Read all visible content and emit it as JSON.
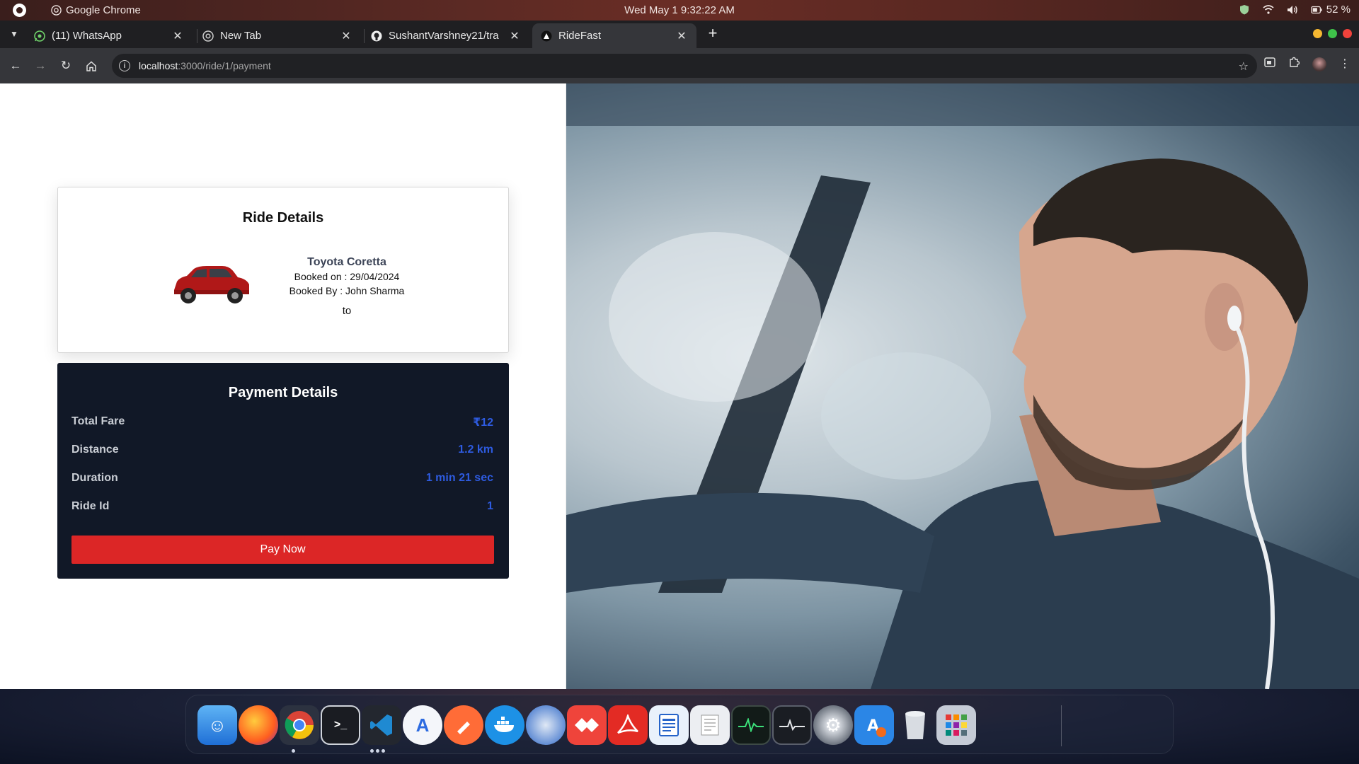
{
  "system_bar": {
    "app_name": "Google Chrome",
    "clock": "Wed May 1   9:32:22 AM",
    "battery": "52 %"
  },
  "tabs": [
    {
      "label": "(11) WhatsApp",
      "icon": "whatsapp-icon"
    },
    {
      "label": "New Tab",
      "icon": "chrome-icon"
    },
    {
      "label": "SushantVarshney21/tra",
      "icon": "github-icon"
    },
    {
      "label": "RideFast",
      "icon": "ridefast-icon",
      "active": true
    }
  ],
  "url": {
    "host": "localhost",
    "path": ":3000/ride/1/payment"
  },
  "ride": {
    "heading": "Ride Details",
    "model": "Toyota Coretta",
    "booked_on": "Booked on : 29/04/2024",
    "booked_by": "Booked By : John Sharma",
    "to": "to"
  },
  "payment": {
    "heading": "Payment Details",
    "rows": [
      {
        "label": "Total Fare",
        "value": "₹12"
      },
      {
        "label": "Distance",
        "value": "1.2 km"
      },
      {
        "label": "Duration",
        "value": "1 min 21 sec"
      },
      {
        "label": "Ride Id",
        "value": "1"
      }
    ],
    "button": "Pay Now"
  },
  "colors": {
    "pay_card_bg": "#111827",
    "pay_value": "#2e5be0",
    "pay_button": "#dc2626"
  },
  "dock_apps": [
    "finder-icon",
    "firefox-icon",
    "chrome-icon",
    "terminal-icon",
    "vscode-icon",
    "app-store-icon",
    "postman-icon",
    "docker-icon",
    "thunderbird-icon",
    "anydesk-icon",
    "acrobat-icon",
    "document-viewer-icon",
    "text-editor-icon",
    "system-monitor-icon",
    "activity-icon",
    "settings-icon",
    "software-updater-icon",
    "trash-icon",
    "app-grid-icon"
  ]
}
